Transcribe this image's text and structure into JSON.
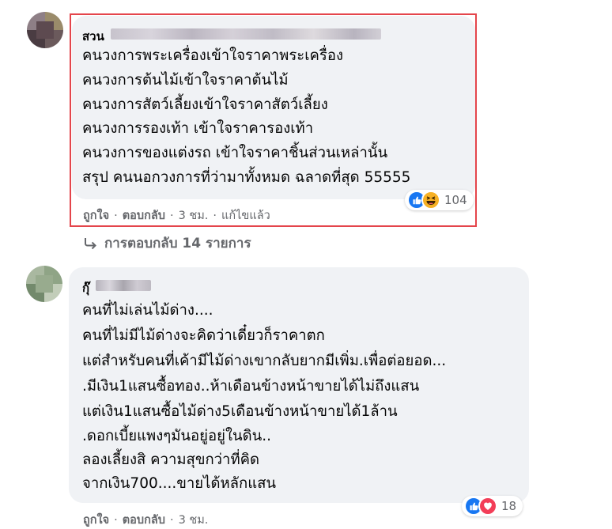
{
  "comment1": {
    "author": "สวน",
    "lines": [
      "คนวงการพระเครื่องเข้าใจราคาพระเครื่อง",
      "คนวงการต้นไม้เข้าใจราคาต้นไม้",
      "คนวงการสัตว์เลี้ยงเข้าใจราคาสัตว์เลี้ยง",
      "คนวงการรองเท้า เข้าใจราคารองเท้า",
      "คนวงการของแต่งรถ เข้าใจราคาชิ้นส่วนเหล่านั้น",
      "สรุป คนนอกวงการที่ว่ามาทั้งหมด ฉลาดที่สุด 55555"
    ],
    "reactions": [
      "like-icon",
      "haha-icon"
    ],
    "reaction_count": "104",
    "like_label": "ถูกใจ",
    "reply_label": "ตอบกลับ",
    "time": "3 ชม.",
    "edited": "แก้ไขแล้ว"
  },
  "replies_link": "การตอบกลับ 14 รายการ",
  "comment2": {
    "author": "กุ๊",
    "lines": [
      "คนที่ไม่เล่นไม้ด่าง....",
      "คนที่ไม่มีไม้ด่างจะคิดว่าเดี๋ยวก็ราคาตก",
      "แต่สำหรับคนที่เค้ามีไม้ด่างเขากลับยากมีเพิ่ม.เพื่อต่อยอด...",
      ".มีเงิน1แสนซื้อทอง..ห้าเดือนข้างหน้าขายได้ไม่ถึงแสน",
      "แต่เงิน1แสนซื้อไม้ด่าง5เดือนข้างหน้าขายได้1ล้าน",
      ".ดอกเบี้ยแพงๆมันอยู่อยู่ในดิน..",
      "ลองเลี้ยงสิ ความสุขกว่าที่คิด",
      "จากเงิน700....ขายได้หลักแสน"
    ],
    "reactions": [
      "like-icon",
      "love-icon"
    ],
    "reaction_count": "18",
    "like_label": "ถูกใจ",
    "reply_label": "ตอบกลับ",
    "time": "3 ชม."
  },
  "colors": {
    "bubble": "#f0f2f5",
    "highlight": "#e4454b",
    "like": "#1877f2",
    "love": "#f33e58",
    "haha": "#f7b125",
    "meta_text": "#65676b"
  }
}
